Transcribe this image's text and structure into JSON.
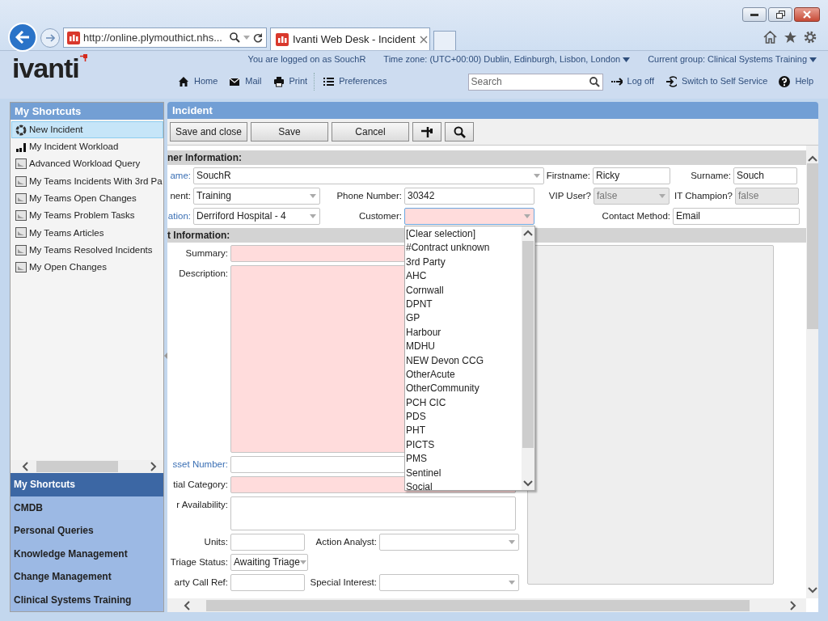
{
  "browser": {
    "address": "http://online.plymouthict.nhs...",
    "tab_title": "Ivanti Web Desk - Incident"
  },
  "header": {
    "logo": "ivanti",
    "logged_on": "You are logged on as SouchR",
    "time_zone": "Time zone: (UTC+00:00) Dublin, Edinburgh, Lisbon, London",
    "current_group": "Current group: Clinical Systems Training",
    "nav": [
      {
        "label": "Home"
      },
      {
        "label": "Mail"
      },
      {
        "label": "Print"
      },
      {
        "label": "Preferences"
      }
    ],
    "search": {
      "placeholder": "Search"
    },
    "actions": [
      {
        "label": "Log off"
      },
      {
        "label": "Switch to Self Service"
      },
      {
        "label": "Help"
      }
    ]
  },
  "sidebar": {
    "title": "My Shortcuts",
    "items": [
      {
        "label": "New Incident",
        "kind": "new",
        "selected": true
      },
      {
        "label": "My Incident Workload",
        "kind": "chart",
        "selected": false
      },
      {
        "label": "Advanced Workload Query",
        "kind": "query",
        "selected": false
      },
      {
        "label": "My Teams Incidents With 3rd Pa",
        "kind": "query",
        "selected": false
      },
      {
        "label": "My Teams Open Changes",
        "kind": "query",
        "selected": false
      },
      {
        "label": "My Teams Problem Tasks",
        "kind": "query",
        "selected": false
      },
      {
        "label": "My Teams Articles",
        "kind": "query",
        "selected": false
      },
      {
        "label": "My Teams Resolved Incidents",
        "kind": "query",
        "selected": false
      },
      {
        "label": "My Open Changes",
        "kind": "query",
        "selected": false
      }
    ],
    "sections": [
      {
        "label": "My Shortcuts",
        "selected": true
      },
      {
        "label": "CMDB",
        "selected": false
      },
      {
        "label": "Personal Queries",
        "selected": false
      },
      {
        "label": "Knowledge Management",
        "selected": false
      },
      {
        "label": "Change Management",
        "selected": false
      },
      {
        "label": "Clinical Systems Training",
        "selected": false
      }
    ]
  },
  "incident": {
    "title": "Incident",
    "buttons": [
      {
        "label": "Save and close"
      },
      {
        "label": "Save"
      },
      {
        "label": "Cancel"
      }
    ],
    "sections": [
      {
        "title": "ner Information:",
        "rows": [
          [
            {
              "label": "ame:",
              "link": true,
              "kind": "select",
              "value": "SouchR",
              "required": false,
              "disabled": false
            },
            {
              "label": "Firstname:",
              "link": false,
              "kind": "text",
              "value": "Ricky",
              "required": false,
              "disabled": false
            },
            {
              "label": "Surname:",
              "link": false,
              "kind": "text",
              "value": "Souch",
              "required": false,
              "disabled": false
            }
          ],
          [
            {
              "label": "nent:",
              "link": false,
              "kind": "select",
              "value": "Training",
              "required": false,
              "disabled": false
            },
            {
              "label": "Phone Number:",
              "link": false,
              "kind": "text",
              "value": "30342",
              "required": false,
              "disabled": false
            },
            {
              "label": "VIP User?",
              "link": false,
              "kind": "select",
              "value": "false",
              "required": false,
              "disabled": true
            },
            {
              "label": "IT Champion?",
              "link": false,
              "kind": "text",
              "value": "false",
              "required": false,
              "disabled": true
            }
          ],
          [
            {
              "label": "ation:",
              "link": true,
              "kind": "select",
              "value": "Derriford Hospital - 4",
              "required": false,
              "disabled": false
            },
            {
              "label": "Customer:",
              "link": false,
              "kind": "select",
              "required": true,
              "disabled": false,
              "expanded": true,
              "options": [
                "[Clear selection]",
                "#Contract unknown",
                "3rd Party",
                "AHC",
                "Cornwall",
                "DPNT",
                "GP",
                "Harbour",
                "MDHU",
                "NEW Devon CCG",
                "OtherAcute",
                "OtherCommunity",
                "PCH CIC",
                "PDS",
                "PHT",
                "PICTS",
                "PMS",
                "Sentinel",
                "Social"
              ]
            },
            {
              "label": "Contact Method:",
              "link": false,
              "kind": "text",
              "value": "Email",
              "required": false,
              "disabled": false
            }
          ]
        ]
      },
      {
        "title": "t Information:",
        "rows": [
          [
            {
              "label": "Summary:",
              "link": false,
              "kind": "text",
              "required": true,
              "disabled": false
            }
          ],
          [
            {
              "label": "Description:",
              "link": false,
              "kind": "textarea",
              "required": true,
              "disabled": false
            }
          ],
          [
            {
              "label": "sset Number:",
              "link": true,
              "kind": "text",
              "required": false,
              "disabled": false
            }
          ],
          [
            {
              "label": "tial Category:",
              "link": false,
              "kind": "text",
              "required": true,
              "disabled": false
            }
          ],
          [
            {
              "label": "r Availability:",
              "link": false,
              "kind": "textarea",
              "required": false,
              "disabled": false
            }
          ],
          [
            {
              "label": "Units:",
              "link": false,
              "kind": "text",
              "required": false,
              "disabled": false
            },
            {
              "label": "Action Analyst:",
              "link": false,
              "kind": "select",
              "required": false,
              "disabled": false
            }
          ],
          [
            {
              "label": "Triage Status:",
              "link": false,
              "kind": "select",
              "value": "Awaiting Triage",
              "required": false,
              "disabled": false
            }
          ],
          [
            {
              "label": "arty Call Ref:",
              "link": false,
              "kind": "text",
              "required": false,
              "disabled": false
            },
            {
              "label": "Special Interest:",
              "link": false,
              "kind": "select",
              "required": false,
              "disabled": false
            }
          ]
        ]
      }
    ]
  }
}
